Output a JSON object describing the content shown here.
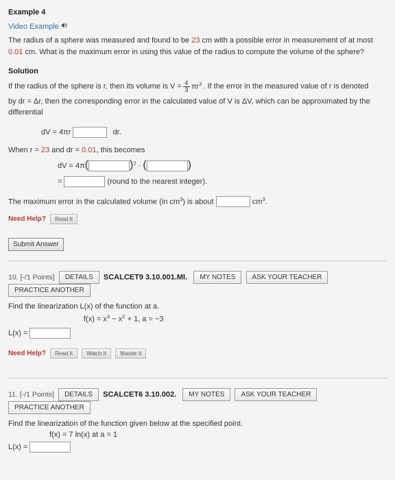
{
  "example": {
    "heading": "Example 4",
    "video_link": "Video Example",
    "problem_1": "The radius of a sphere was measured and found to be ",
    "val_23": "23",
    "problem_2": " cm with a possible error in measurement of at most ",
    "val_001": "0.01",
    "problem_3": " cm. What is the maximum error in using this value of the radius to compute the volume of the sphere?",
    "solution_heading": "Solution",
    "sol_line1_a": "If the radius of the sphere is r, then its volume is V = ",
    "sol_frac_num": "4",
    "sol_frac_den": "3",
    "sol_line1_b": "πr",
    "sol_line1_c": ". If the error in the measured value of r is denoted",
    "sol_line2": "by dr = Δr, then the corresponding error in the calculated value of V is ΔV, which can be approximated by the differential",
    "dv_eq_prefix": "dV = 4πr",
    "dv_eq_suffix": "dr.",
    "when_line_a": "When r = ",
    "when_r": "23",
    "when_line_b": " and dr = ",
    "when_dr": "0.01",
    "when_line_c": ", this becomes",
    "dv2_prefix": "dV = 4π",
    "round_note": "(round to the nearest integer).",
    "max_err_a": "The maximum error in the calculated volume (in cm",
    "max_err_b": ") is about ",
    "max_err_unit": " cm",
    "need_help": "Need Help?",
    "read_it": "Read It",
    "submit": "Submit Answer"
  },
  "q10": {
    "num": "10. [-/1 Points]",
    "details": "DETAILS",
    "ref": "SCALCET9 3.10.001.MI.",
    "mynotes": "MY NOTES",
    "ask": "ASK YOUR TEACHER",
    "practice": "PRACTICE ANOTHER",
    "stem": "Find the linearization L(x) of the function at a.",
    "fx": "f(x) = x",
    "fx_mid": " − x",
    "fx_tail": " + 1,    a = −3",
    "Lx": "L(x) = ",
    "need_help": "Need Help?",
    "read_it": "Read It",
    "watch_it": "Watch It",
    "master_it": "Master It"
  },
  "q11": {
    "num": "11. [-/1 Points]",
    "details": "DETAILS",
    "ref": "SCALCET6 3.10.002.",
    "mynotes": "MY NOTES",
    "ask": "ASK YOUR TEACHER",
    "practice": "PRACTICE ANOTHER",
    "stem": "Find the linearization of the function given below at the specified point.",
    "fx": "f(x) = 7 ln(x) at a = 1",
    "Lx": "L(x) = "
  }
}
